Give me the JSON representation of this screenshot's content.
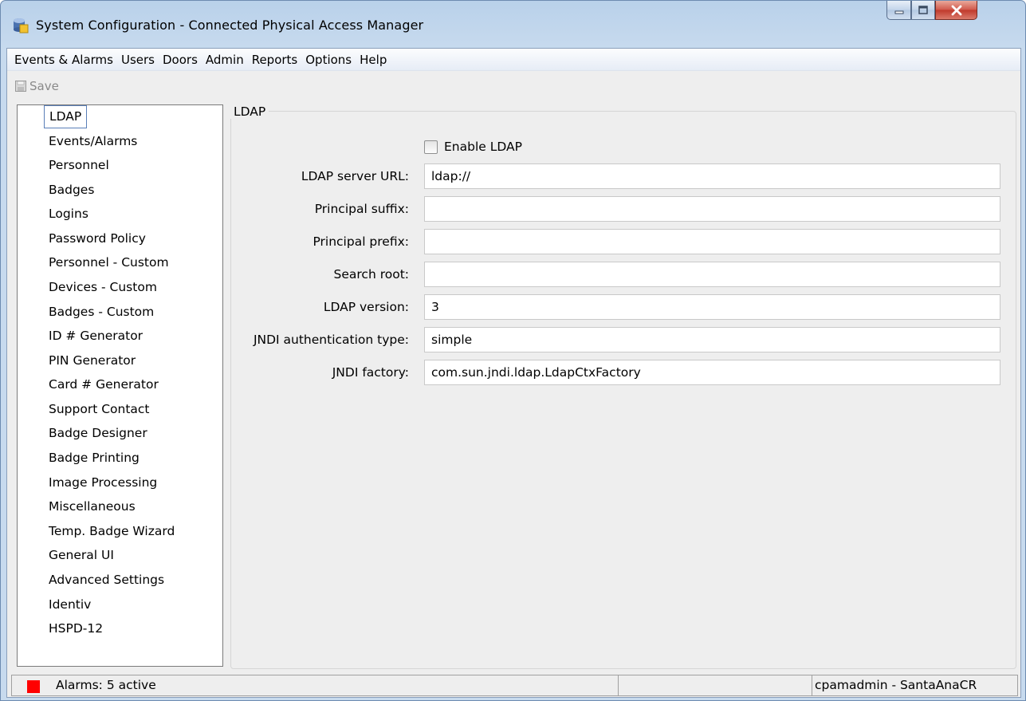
{
  "window": {
    "title": "System Configuration - Connected Physical Access Manager",
    "controls": {
      "minimize": "minimize-icon",
      "maximize": "maximize-icon",
      "close": "close-icon"
    }
  },
  "menu": [
    "Events & Alarms",
    "Users",
    "Doors",
    "Admin",
    "Reports",
    "Options",
    "Help"
  ],
  "toolbar": {
    "save_label": "Save",
    "save_icon": "floppy-disk-icon"
  },
  "nav": {
    "selected": "LDAP",
    "items": [
      "LDAP",
      "Events/Alarms",
      "Personnel",
      "Badges",
      "Logins",
      "Password Policy",
      "Personnel - Custom",
      "Devices - Custom",
      "Badges - Custom",
      "ID # Generator",
      "PIN Generator",
      "Card # Generator",
      "Support Contact",
      "Badge Designer",
      "Badge Printing",
      "Image Processing",
      "Miscellaneous",
      "Temp. Badge Wizard",
      "General UI",
      "Advanced Settings",
      "Identiv",
      "HSPD-12"
    ]
  },
  "panel": {
    "title": "LDAP",
    "enable_label": "Enable LDAP",
    "enable_checked": false,
    "fields": [
      {
        "label": "LDAP server URL:",
        "value": "ldap://"
      },
      {
        "label": "Principal suffix:",
        "value": ""
      },
      {
        "label": "Principal prefix:",
        "value": ""
      },
      {
        "label": "Search root:",
        "value": ""
      },
      {
        "label": "LDAP version:",
        "value": "3"
      },
      {
        "label": "JNDI authentication type:",
        "value": "simple"
      },
      {
        "label": "JNDI factory:",
        "value": "com.sun.jndi.ldap.LdapCtxFactory"
      }
    ]
  },
  "status": {
    "alarm_color": "#ff0000",
    "alarms_text": "Alarms: 5 active",
    "user_text": "cpamadmin - SantaAnaCR"
  }
}
